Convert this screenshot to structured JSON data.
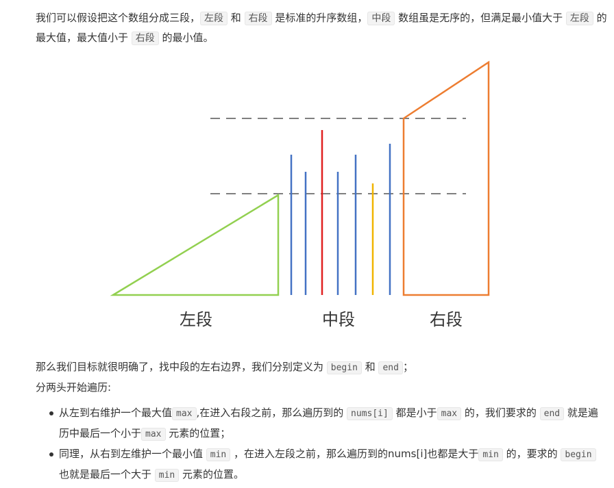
{
  "intro": {
    "t1": "我们可以假设把这个数组分成三段，",
    "c_left": "左段",
    "t2": " 和 ",
    "c_right": "右段",
    "t3": " 是标准的升序数组，",
    "c_mid": "中段",
    "t4": " 数组虽是无序的，但满足最小值大于 ",
    "c_left2": "左段",
    "t5": " 的最大值，最大值小于 ",
    "c_right2": "右段",
    "t6": " 的最小值。"
  },
  "diagram": {
    "labels": {
      "left": "左段",
      "middle": "中段",
      "right": "右段"
    },
    "colors": {
      "left": "#92d050",
      "right": "#ed7d31",
      "blue": "#4472c4",
      "red": "#e02020",
      "yellow": "#f0b400",
      "dash": "#7f7f7f"
    }
  },
  "para2": {
    "t1": "那么我们目标就很明确了，找中段的左右边界，我们分别定义为 ",
    "c_begin": "begin",
    "t2": "  和 ",
    "c_end": "end",
    "t3": "；",
    "line2": "分两头开始遍历:"
  },
  "bullets": {
    "b1": {
      "t1": "从左到右维护一个最大值",
      "c_max": "max",
      "t2": ",在进入右段之前，那么遍历到的 ",
      "c_nums": "nums[i]",
      "t3": " 都是小于",
      "c_max2": "max",
      "t4": " 的，我们要求的 ",
      "c_end": "end",
      "t5": " 就是遍历中最后一个小于",
      "c_max3": "max",
      "t6": " 元素的位置；"
    },
    "b2": {
      "t1": "同理，从右到左维护一个最小值 ",
      "c_min": "min",
      "t2": " ，在进入左段之前，那么遍历到的nums[i]也都是大于",
      "c_min2": "min",
      "t3": " 的，要求的 ",
      "c_begin": "begin",
      "t4": " 也就是最后一个大于 ",
      "c_min3": "min",
      "t5": " 元素的位置。"
    }
  }
}
